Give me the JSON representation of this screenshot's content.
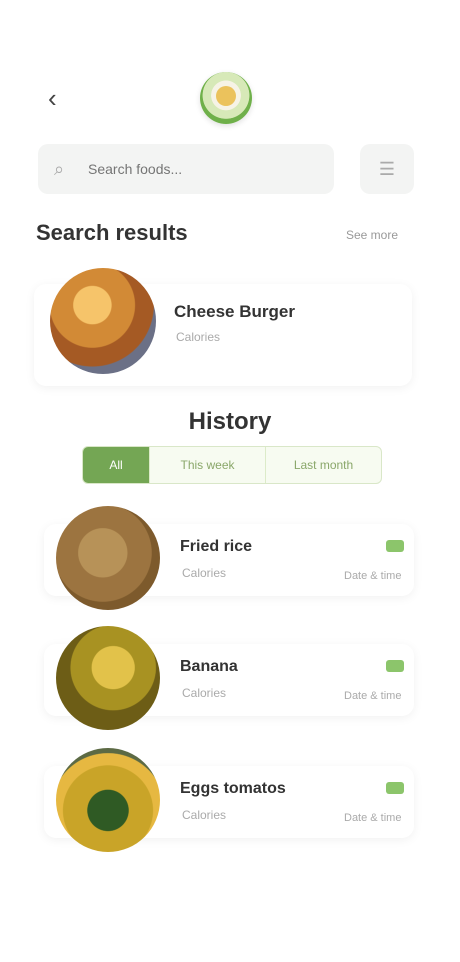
{
  "header": {
    "back_icon": "back-arrow-icon",
    "logo_icon": "app-logo-icon"
  },
  "search": {
    "placeholder": "Search foods...",
    "search_icon": "search-icon",
    "filter_icon": "filter-icon"
  },
  "results": {
    "title": "Search results",
    "see_more": "See more",
    "items": [
      {
        "title": "Cheese Burger",
        "subtitle": "Calories",
        "icon": "burger-image"
      }
    ]
  },
  "history": {
    "title": "History",
    "tabs": [
      {
        "label": "All"
      },
      {
        "label": "This week"
      },
      {
        "label": "Last month"
      }
    ],
    "items": [
      {
        "title": "Fried rice",
        "subtitle": "Calories",
        "date": "Date & time",
        "badge_color": "#8cc56b"
      },
      {
        "title": "Banana",
        "subtitle": "Calories",
        "date": "Date & time",
        "badge_color": "#8cc56b"
      },
      {
        "title": "Eggs tomatos",
        "subtitle": "Calories",
        "date": "Date & time",
        "badge_color": "#8cc56b"
      }
    ]
  },
  "colors": {
    "accent": "#74a654",
    "badge": "#8cc56b",
    "background": "#ffffff"
  }
}
